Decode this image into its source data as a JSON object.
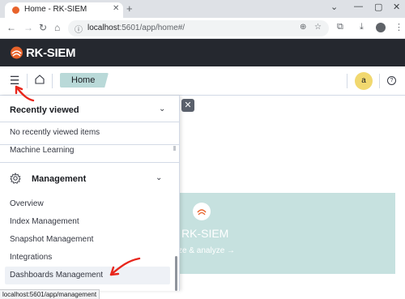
{
  "browser": {
    "tab_title": "Home - RK-SIEM",
    "tab_close": "✕",
    "new_tab": "+",
    "url_host": "localhost",
    "url_path": ":5601/app/home#/",
    "status_url": "localhost:5601/app/management",
    "window_controls": [
      "⌄",
      "—",
      "▢",
      "✕"
    ]
  },
  "app": {
    "brand": "RK-SIEM",
    "brand_color": "#e8632b",
    "breadcrumb": "Home",
    "avatar_letter": "a",
    "help": "?"
  },
  "flyout": {
    "recent": {
      "title": "Recently viewed",
      "empty_text": "No recently viewed items"
    },
    "partial_item": "Machine Learning",
    "management": {
      "title": "Management",
      "items": [
        "Overview",
        "Index Management",
        "Snapshot Management",
        "Integrations",
        "Dashboards Management"
      ]
    },
    "close": "✕"
  },
  "hero": {
    "title": "RK-SIEM",
    "subtitle": "alize & analyze →"
  },
  "annotations": {
    "arrow_color": "#e8261c"
  }
}
